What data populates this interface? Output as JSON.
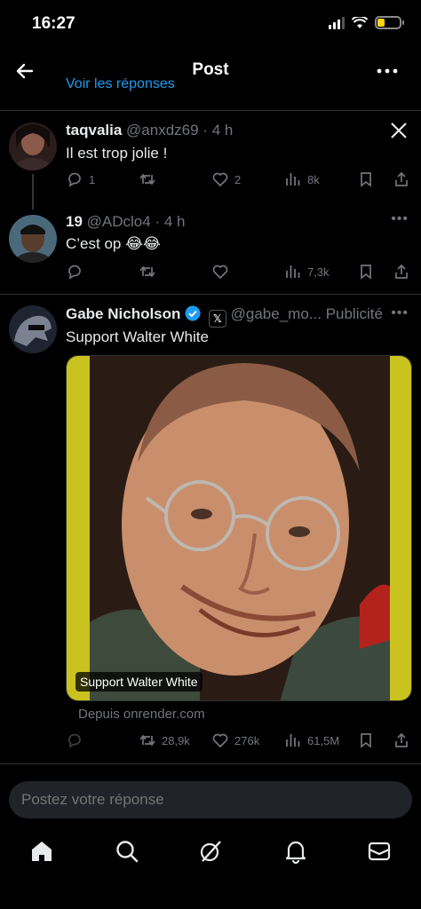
{
  "status": {
    "time": "16:27"
  },
  "header": {
    "title": "Post",
    "back_icon": "arrow-left-icon",
    "more_icon": "ellipsis-icon"
  },
  "cut_reply": {
    "text": "Voir les réponses"
  },
  "tweets": [
    {
      "name": "taqvalia",
      "handle": "@anxdz69",
      "time": "· 4 h",
      "text": "Il est trop jolie !",
      "replies": "1",
      "retweets": "",
      "likes": "2",
      "views": "8k",
      "corner_icon": "x-logo-icon"
    },
    {
      "name": "19",
      "handle": "@ADclo4",
      "time": "· 4 h",
      "text": "C’est op 😂😂",
      "replies": "",
      "retweets": "",
      "likes": "",
      "views": "7,3k",
      "corner_icon": "ellipsis-icon"
    },
    {
      "name": "Gabe Nicholson",
      "handle": "@gabe_mo...",
      "time": "",
      "ad_label": "Publicité",
      "text": "Support Walter White",
      "media_caption": "Support Walter White",
      "source": "Depuis onrender.com",
      "replies": "",
      "retweets": "28,9k",
      "likes": "276k",
      "views": "61,5M",
      "corner_icon": "ellipsis-icon"
    }
  ],
  "compose": {
    "placeholder": "Postez votre réponse"
  },
  "tabbar": {
    "items": [
      "home-icon",
      "search-icon",
      "grok-icon",
      "bell-icon",
      "mail-icon"
    ]
  },
  "colors": {
    "accent": "#1d9bf0",
    "verified": "#1d9bf0",
    "muted": "#71767b",
    "background": "#000000"
  }
}
